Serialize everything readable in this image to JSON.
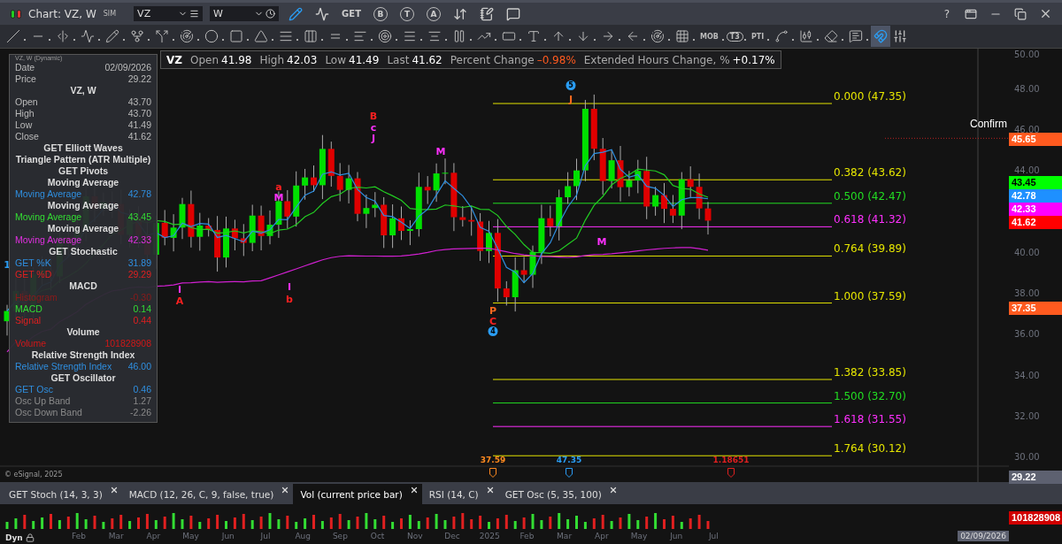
{
  "window": {
    "title": "Chart: VZ, W",
    "mode_badge": "SIM",
    "symbol": "VZ",
    "interval": "W",
    "toolbar_texts": [
      "GET",
      "B",
      "T",
      "A"
    ],
    "help": "?"
  },
  "drawing_toolbar": {
    "text_tools": [
      "MOB",
      "T3",
      "PTI"
    ],
    "magnet": {
      "selected": true
    }
  },
  "quote": {
    "symbol": "VZ",
    "fields": [
      {
        "label": "Open",
        "value": "41.98",
        "color": "#ffffff"
      },
      {
        "label": "High",
        "value": "42.03",
        "color": "#ffffff"
      },
      {
        "label": "Low",
        "value": "41.49",
        "color": "#ffffff"
      },
      {
        "label": "Last",
        "value": "41.62",
        "color": "#ffffff"
      },
      {
        "label": "Percent Change",
        "value": "–0.98%",
        "color": "#ff5a1f"
      },
      {
        "label": "Extended Hours Change, %",
        "value": "+0.17%",
        "color": "#ffffff"
      }
    ]
  },
  "data_window": {
    "title": "VZ, W (Dynamic)",
    "rows": [
      {
        "kind": "row",
        "label": "Date",
        "value": "02/09/2026",
        "color": "#bbbbbb"
      },
      {
        "kind": "row",
        "label": "Price",
        "value": "29.22",
        "color": "#bbbbbb"
      },
      {
        "kind": "header",
        "label": "VZ, W"
      },
      {
        "kind": "row",
        "label": "Open",
        "value": "43.70",
        "color": "#bbbbbb"
      },
      {
        "kind": "row",
        "label": "High",
        "value": "43.70",
        "color": "#bbbbbb"
      },
      {
        "kind": "row",
        "label": "Low",
        "value": "41.49",
        "color": "#bbbbbb"
      },
      {
        "kind": "row",
        "label": "Close",
        "value": "41.62",
        "color": "#bbbbbb"
      },
      {
        "kind": "header",
        "label": "GET Elliott Waves"
      },
      {
        "kind": "header",
        "label": "Triangle Pattern (ATR Multiple)"
      },
      {
        "kind": "header",
        "label": "GET Pivots"
      },
      {
        "kind": "header",
        "label": "Moving Average"
      },
      {
        "kind": "row",
        "label": "Moving Average",
        "value": "42.78",
        "color": "#2f8fe0"
      },
      {
        "kind": "header",
        "label": "Moving Average"
      },
      {
        "kind": "row",
        "label": "Moving Average",
        "value": "43.45",
        "color": "#33dd33"
      },
      {
        "kind": "header",
        "label": "Moving Average"
      },
      {
        "kind": "row",
        "label": "Moving Average",
        "value": "42.33",
        "color": "#e030e0"
      },
      {
        "kind": "header",
        "label": "GET Stochastic"
      },
      {
        "kind": "row",
        "label": "GET %K",
        "value": "31.89",
        "color": "#2f8fe0"
      },
      {
        "kind": "row",
        "label": "GET %D",
        "value": "29.29",
        "color": "#e02020"
      },
      {
        "kind": "header",
        "label": "MACD"
      },
      {
        "kind": "row",
        "label": "Histogram",
        "value": "-0.30",
        "color": "#8b1a1a"
      },
      {
        "kind": "row",
        "label": "MACD",
        "value": "0.14",
        "color": "#33dd33"
      },
      {
        "kind": "row",
        "label": "Signal",
        "value": "0.44",
        "color": "#e02020"
      },
      {
        "kind": "header",
        "label": "Volume"
      },
      {
        "kind": "row",
        "label": "Volume",
        "value": "101828908",
        "color": "#d01818"
      },
      {
        "kind": "header",
        "label": "Relative Strength Index"
      },
      {
        "kind": "row",
        "label": "Relative Strength Index",
        "value": "46.00",
        "color": "#2f8fe0"
      },
      {
        "kind": "header",
        "label": "GET Oscillator"
      },
      {
        "kind": "row",
        "label": "GET Osc",
        "value": "0.46",
        "color": "#2f8fe0"
      },
      {
        "kind": "row",
        "label": "Osc Up Band",
        "value": "1.27",
        "color": "#8a8a8a"
      },
      {
        "kind": "row",
        "label": "Osc Down Band",
        "value": "-2.26",
        "color": "#8a8a8a"
      }
    ]
  },
  "chart": {
    "copyright": "© eSignal, 2025",
    "confirm_text": "Confirm",
    "fib_levels": [
      {
        "label": "0.000 (47.35)",
        "color": "#e5e500"
      },
      {
        "label": "0.382 (43.62)",
        "color": "#e5e500"
      },
      {
        "label": "0.500 (42.47)",
        "color": "#22dd22"
      },
      {
        "label": "0.618 (41.32)",
        "color": "#ff30ff"
      },
      {
        "label": "0.764 (39.89)",
        "color": "#e5e500"
      },
      {
        "label": "1.000 (37.59)",
        "color": "#e5e500"
      },
      {
        "label": "1.382 (33.85)",
        "color": "#e5e500"
      },
      {
        "label": "1.500 (32.70)",
        "color": "#22dd22"
      },
      {
        "label": "1.618 (31.55)",
        "color": "#ff30ff"
      },
      {
        "label": "1.764 (30.12)",
        "color": "#e5e500"
      }
    ],
    "wave_labels": [
      {
        "kind": "circle",
        "text": "5",
        "color": "#2a9df4"
      },
      {
        "kind": "letter",
        "text": "J",
        "color": "#ff6a1f"
      },
      {
        "kind": "letter",
        "text": "B",
        "color": "#ff2020"
      },
      {
        "kind": "letter",
        "text": "c",
        "color": "#ff30ff"
      },
      {
        "kind": "letter",
        "text": "J",
        "color": "#ff30ff"
      },
      {
        "kind": "letter",
        "text": "M",
        "color": "#ff30ff"
      },
      {
        "kind": "letter",
        "text": "a",
        "color": "#ff2020"
      },
      {
        "kind": "letter",
        "text": "M",
        "color": "#ff30ff"
      },
      {
        "kind": "letter",
        "text": "I",
        "color": "#ff30ff"
      },
      {
        "kind": "letter",
        "text": "A",
        "color": "#ff2020"
      },
      {
        "kind": "letter",
        "text": "I",
        "color": "#ff30ff"
      },
      {
        "kind": "letter",
        "text": "b",
        "color": "#ff2020"
      },
      {
        "kind": "letter",
        "text": "P",
        "color": "#ff6a1f"
      },
      {
        "kind": "letter",
        "text": "C",
        "color": "#ff2020"
      },
      {
        "kind": "circle",
        "text": "4",
        "color": "#2a9df4"
      },
      {
        "kind": "letter",
        "text": "M",
        "color": "#ff30ff"
      },
      {
        "kind": "letter",
        "text": "1",
        "color": "#2a9df4"
      }
    ],
    "markers": [
      {
        "text": "37.59",
        "color": "#ff8a1f"
      },
      {
        "text": "47.35",
        "color": "#2a9df4"
      },
      {
        "text": "1.18651",
        "color": "#e02020"
      }
    ],
    "price_ticks": [
      "50.00",
      "48.00",
      "46.00",
      "44.00",
      "40.00",
      "38.00",
      "36.00",
      "34.00",
      "32.00",
      "30.00"
    ],
    "price_tags": [
      {
        "value": "45.65",
        "color": "#ff5a1f"
      },
      {
        "value": "43.45",
        "color": "#00ff00"
      },
      {
        "value": "42.78",
        "color": "#1e90ff"
      },
      {
        "value": "42.33",
        "color": "#ff00ff"
      },
      {
        "value": "41.62",
        "color": "#ff0000"
      },
      {
        "value": "37.35",
        "color": "#ff5a1f"
      },
      {
        "value": "29.22",
        "color": "#5d6170"
      }
    ]
  },
  "tabs": [
    {
      "label": "GET Stoch (14, 3, 3)",
      "selected": false
    },
    {
      "label": "MACD (12, 26, C, 9, false, true)",
      "selected": false
    },
    {
      "label": "Vol (current price bar)",
      "selected": true
    },
    {
      "label": "RSI (14, C)",
      "selected": false
    },
    {
      "label": "GET Osc (5, 35, 100)",
      "selected": false
    }
  ],
  "volume": {
    "tag": "101828908",
    "mode": "Dyn",
    "date_tag": "02/09/2026",
    "months": [
      "Feb",
      "Mar",
      "Apr",
      "May",
      "Jun",
      "Jul",
      "Aug",
      "Sep",
      "Oct",
      "Nov",
      "Dec",
      "2025",
      "Feb",
      "Mar",
      "Apr",
      "May",
      "Jun",
      "Jul"
    ]
  }
}
